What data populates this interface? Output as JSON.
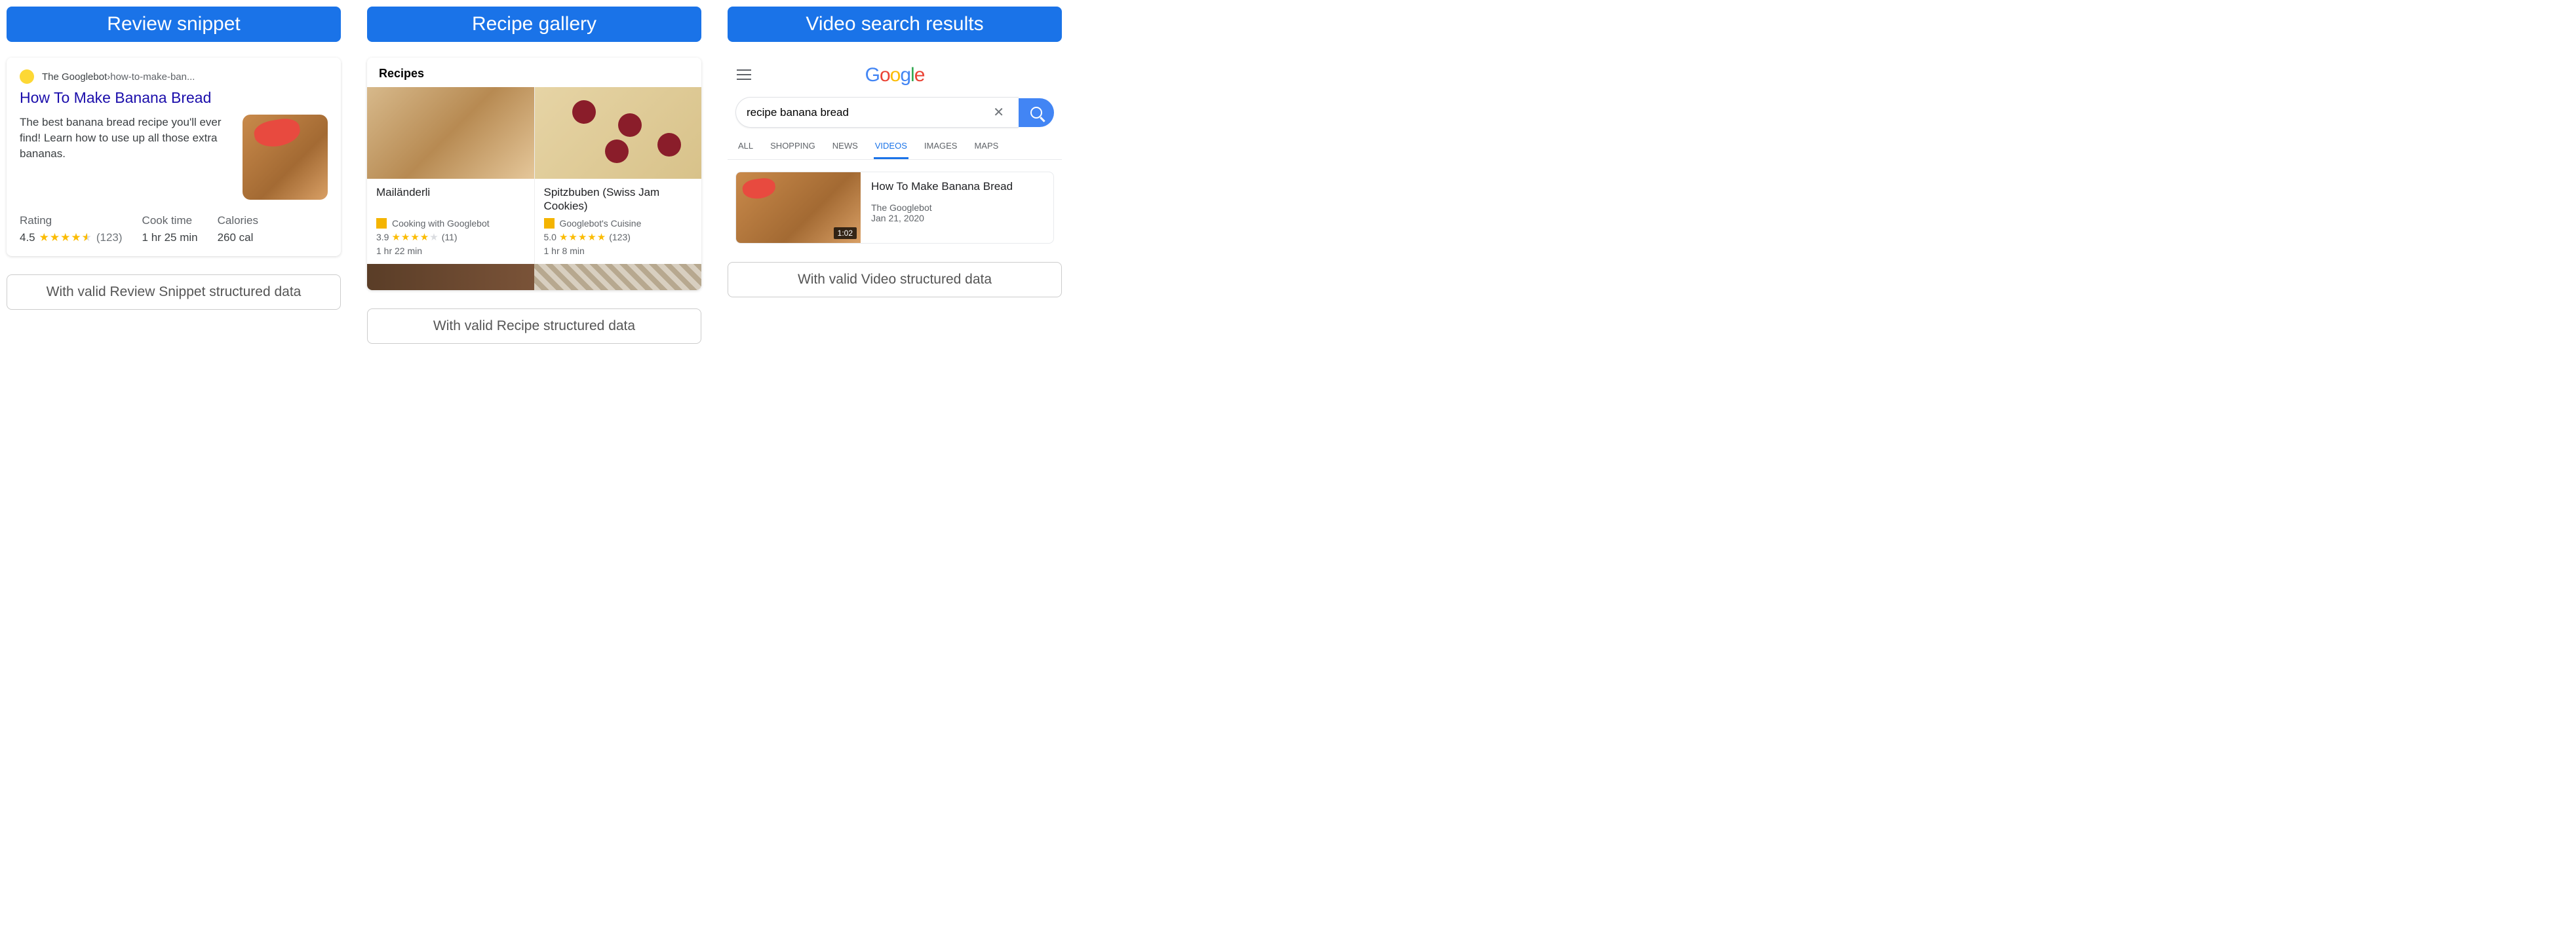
{
  "columns": {
    "review": {
      "header": "Review snippet",
      "footer": "With valid Review Snippet structured data",
      "breadcrumb_site": "The Googlebot",
      "breadcrumb_sep": " › ",
      "breadcrumb_path": "how-to-make-ban...",
      "title": "How To Make Banana Bread",
      "description": "The best banana bread recipe you'll ever find! Learn how to use up all those extra bananas.",
      "metrics": {
        "rating_label": "Rating",
        "rating_value": "4.5",
        "rating_count": "(123)",
        "cook_label": "Cook time",
        "cook_value": "1 hr 25 min",
        "cal_label": "Calories",
        "cal_value": "260 cal"
      }
    },
    "gallery": {
      "header": "Recipe gallery",
      "footer": "With valid Recipe structured data",
      "title": "Recipes",
      "recipes": [
        {
          "name": "Mailänderli",
          "source": "Cooking with Googlebot",
          "rating": "3.9",
          "count": "(11)",
          "time": "1 hr 22 min"
        },
        {
          "name": "Spitzbuben (Swiss Jam Cookies)",
          "source": "Googlebot's Cuisine",
          "rating": "5.0",
          "count": "(123)",
          "time": "1 hr 8 min"
        }
      ]
    },
    "video": {
      "header": "Video search results",
      "footer": "With valid Video structured data",
      "logo_letters": [
        "G",
        "o",
        "o",
        "g",
        "l",
        "e"
      ],
      "search_query": "recipe banana bread",
      "tabs": [
        "ALL",
        "SHOPPING",
        "NEWS",
        "VIDEOS",
        "IMAGES",
        "MAPS"
      ],
      "active_tab": "VIDEOS",
      "result": {
        "title": "How To Make Banana Bread",
        "channel": "The Googlebot",
        "date": "Jan 21, 2020",
        "duration": "1:02"
      }
    }
  }
}
